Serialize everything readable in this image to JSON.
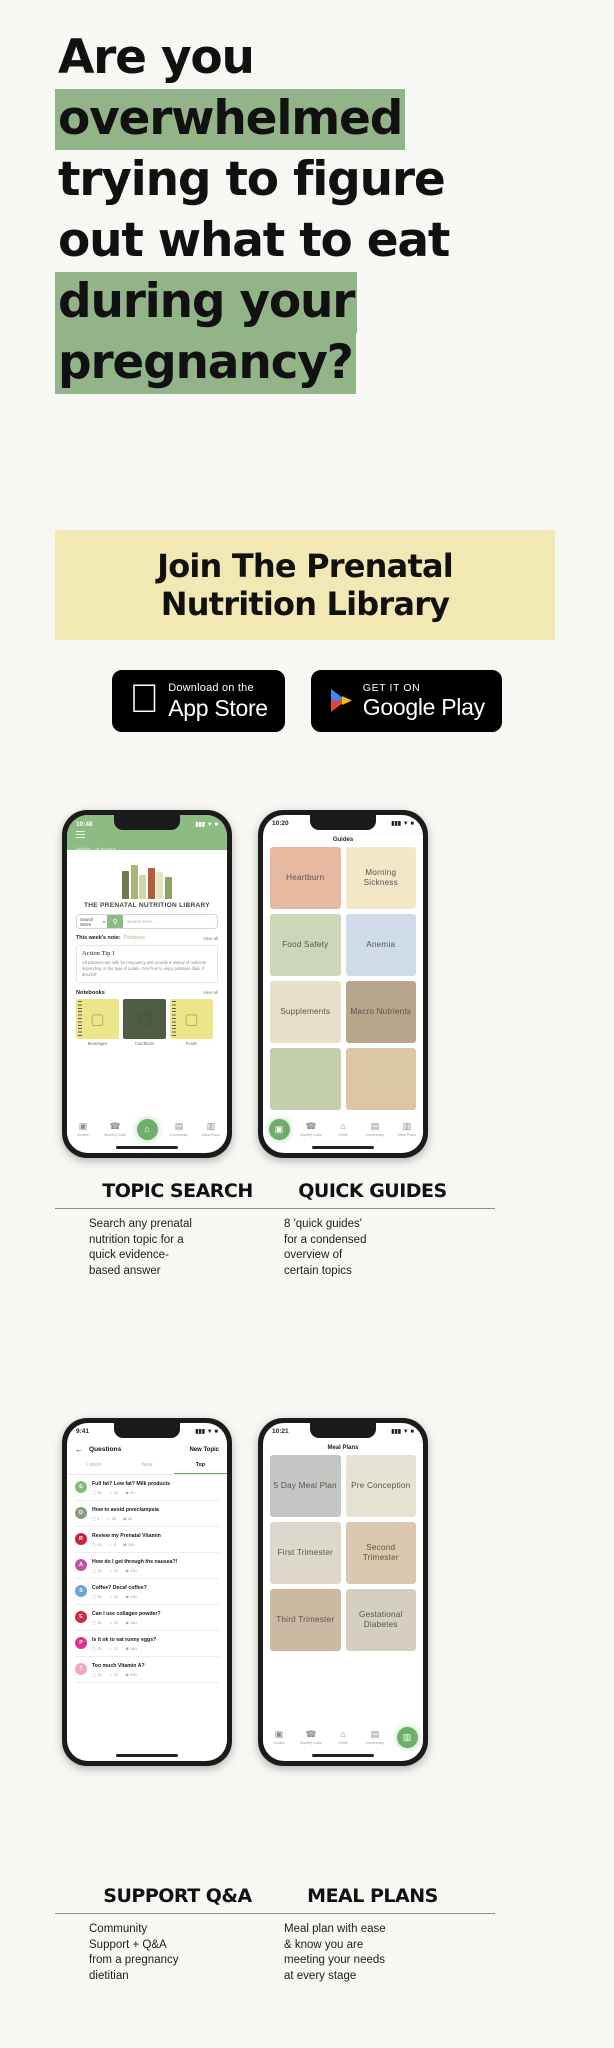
{
  "headline": {
    "lines": [
      {
        "text": "Are you",
        "highlight": false
      },
      {
        "text": "overwhelmed",
        "highlight": true
      },
      {
        "text": "trying to figure",
        "highlight": false
      },
      {
        "text": "out what to eat",
        "highlight": false
      },
      {
        "text": "during your",
        "highlight": true
      },
      {
        "text": "pregnancy?",
        "highlight": true
      }
    ],
    "highlight_color": "#93b488"
  },
  "cta": {
    "line1": "Join The Prenatal",
    "line2": "Nutrition Library",
    "background": "#f2e8b4"
  },
  "badges": {
    "apple": {
      "small": "Download on the",
      "big": "App Store",
      "icon": "apple-icon"
    },
    "google": {
      "small": "GET IT ON",
      "big": "Google Play",
      "icon": "google-play-icon"
    }
  },
  "phones": {
    "topic_search": {
      "status_time": "10:48",
      "greeting": "Hello, autumn",
      "library_title": "THE PRENATAL NUTRITION LIBRARY",
      "search": {
        "selector": "Search Notes",
        "placeholder": "Search here..."
      },
      "note_label": "This week's note:",
      "note_value": "Potatoes",
      "view_all": "View all",
      "tip_title": "Action Tip 1",
      "tip_body": "All potatoes are safe for pregnancy and provide a variety of nutrients depending on the type of potato. Feel free to enjoy potatoes daily, if desired!",
      "notebooks_title": "Notebooks",
      "notebooks": [
        {
          "label": "Beverages",
          "color": "#ece589",
          "glyph": "☕"
        },
        {
          "label": "Conditions",
          "color": "#4d5c43",
          "glyph": "ὌB"
        },
        {
          "label": "Foods",
          "color": "#ece589",
          "glyph": "☕"
        }
      ],
      "tabs": [
        {
          "label": "Guides",
          "icon": "guides-icon",
          "glyph": "▣",
          "active": false
        },
        {
          "label": "Monthly Calls",
          "icon": "phone-icon",
          "glyph": "☎",
          "active": false
        },
        {
          "label": "Home",
          "icon": "home-icon",
          "glyph": "⌂",
          "active": true
        },
        {
          "label": "Community",
          "icon": "community-icon",
          "glyph": "▤",
          "active": false
        },
        {
          "label": "Meal Plans",
          "icon": "meal-plans-icon",
          "glyph": "▥",
          "active": false
        }
      ]
    },
    "quick_guides": {
      "status_time": "10:20",
      "title": "Guides",
      "cards": [
        {
          "label": "Heartburn",
          "color": "#e8b9a1"
        },
        {
          "label": "Morning Sickness",
          "color": "#f3e7c8"
        },
        {
          "label": "Food Safety",
          "color": "#cdd6b7"
        },
        {
          "label": "Anemia",
          "color": "#cfdbe6"
        },
        {
          "label": "Supplements",
          "color": "#e6e0c9"
        },
        {
          "label": "Macro Nutrients",
          "color": "#b8a68c"
        },
        {
          "label": "",
          "color": "#c5cfae"
        },
        {
          "label": "",
          "color": "#ddc6a6"
        }
      ],
      "tabs": [
        {
          "label": "Guides",
          "icon": "guides-icon",
          "glyph": "▣",
          "active": true
        },
        {
          "label": "Monthly Calls",
          "icon": "phone-icon",
          "glyph": "☎",
          "active": false
        },
        {
          "label": "Home",
          "icon": "home-icon",
          "glyph": "⌂",
          "active": false
        },
        {
          "label": "Community",
          "icon": "community-icon",
          "glyph": "▤",
          "active": false
        },
        {
          "label": "Meal Plans",
          "icon": "meal-plans-icon",
          "glyph": "▥",
          "active": false
        }
      ]
    },
    "support_qa": {
      "status_time": "9:41",
      "title": "Questions",
      "new_topic": "New Topic",
      "tabs": [
        "Latest",
        "New",
        "Top"
      ],
      "active_tab": "Top",
      "questions": [
        {
          "avatar": "E",
          "color": "#7fbf72",
          "text": "Full fat? Low fat? Milk products",
          "comments": "15",
          "likes": "12",
          "time": "2h"
        },
        {
          "avatar": "D",
          "color": "#8a9c7a",
          "text": "How to avoid preeclampsia",
          "comments": "2",
          "likes": "20",
          "time": "5h"
        },
        {
          "avatar": "R",
          "color": "#c9243f",
          "text": "Review my Prenatal Vitamin",
          "comments": "24",
          "likes": "5",
          "time": "10h"
        },
        {
          "avatar": "A",
          "color": "#c252a8",
          "text": "How do I get through the nausea?!",
          "comments": "15",
          "likes": "12",
          "time": "12h"
        },
        {
          "avatar": "S",
          "color": "#6fa4d6",
          "text": "Coffee? Decaf coffee?",
          "comments": "15",
          "likes": "12",
          "time": "14h"
        },
        {
          "avatar": "E",
          "color": "#d42b3a",
          "text": "Can I use collagen powder?",
          "comments": "15",
          "likes": "12",
          "time": "16h"
        },
        {
          "avatar": "P",
          "color": "#e0328c",
          "text": "Is it ok to eat runny eggs?",
          "comments": "15",
          "likes": "12",
          "time": "18h"
        },
        {
          "avatar": "T",
          "color": "#f3a6c8",
          "text": "Too much Vitamin A?",
          "comments": "15",
          "likes": "12",
          "time": "20h"
        }
      ]
    },
    "meal_plans": {
      "status_time": "10:21",
      "title": "Meal Plans",
      "cards": [
        {
          "label": "5 Day Meal Plan",
          "color": "#c3c6c3"
        },
        {
          "label": "Pre Conception",
          "color": "#e6e3d3"
        },
        {
          "label": "First Trimester",
          "color": "#ddd7cc"
        },
        {
          "label": "Second Trimester",
          "color": "#d9c8ae"
        },
        {
          "label": "Third Trimester",
          "color": "#cbb9a2"
        },
        {
          "label": "Gestational Diabetes",
          "color": "#d5cfc0"
        }
      ],
      "tabs": [
        {
          "label": "Guides",
          "icon": "guides-icon",
          "glyph": "▣",
          "active": false
        },
        {
          "label": "Monthly Calls",
          "icon": "phone-icon",
          "glyph": "☎",
          "active": false
        },
        {
          "label": "Home",
          "icon": "home-icon",
          "glyph": "⌂",
          "active": false
        },
        {
          "label": "Community",
          "icon": "community-icon",
          "glyph": "▤",
          "active": false
        },
        {
          "label": "Meal Plans",
          "icon": "meal-plans-icon",
          "glyph": "▥",
          "active": true
        }
      ]
    }
  },
  "captions": {
    "topic_search": {
      "title": "TOPIC SEARCH",
      "body": "Search any prenatal\nnutrition topic for a\nquick evidence-\nbased answer"
    },
    "quick_guides": {
      "title": "QUICK GUIDES",
      "body": "8 'quick guides'\nfor a condensed\noverview of\ncertain topics"
    },
    "support_qa": {
      "title": "SUPPORT Q&A",
      "body": "Community\nSupport + Q&A\nfrom a pregnancy\ndietitian"
    },
    "meal_plans": {
      "title": "MEAL PLANS",
      "body": "Meal plan with ease\n& know you are\nmeeting your needs\nat every stage"
    }
  }
}
